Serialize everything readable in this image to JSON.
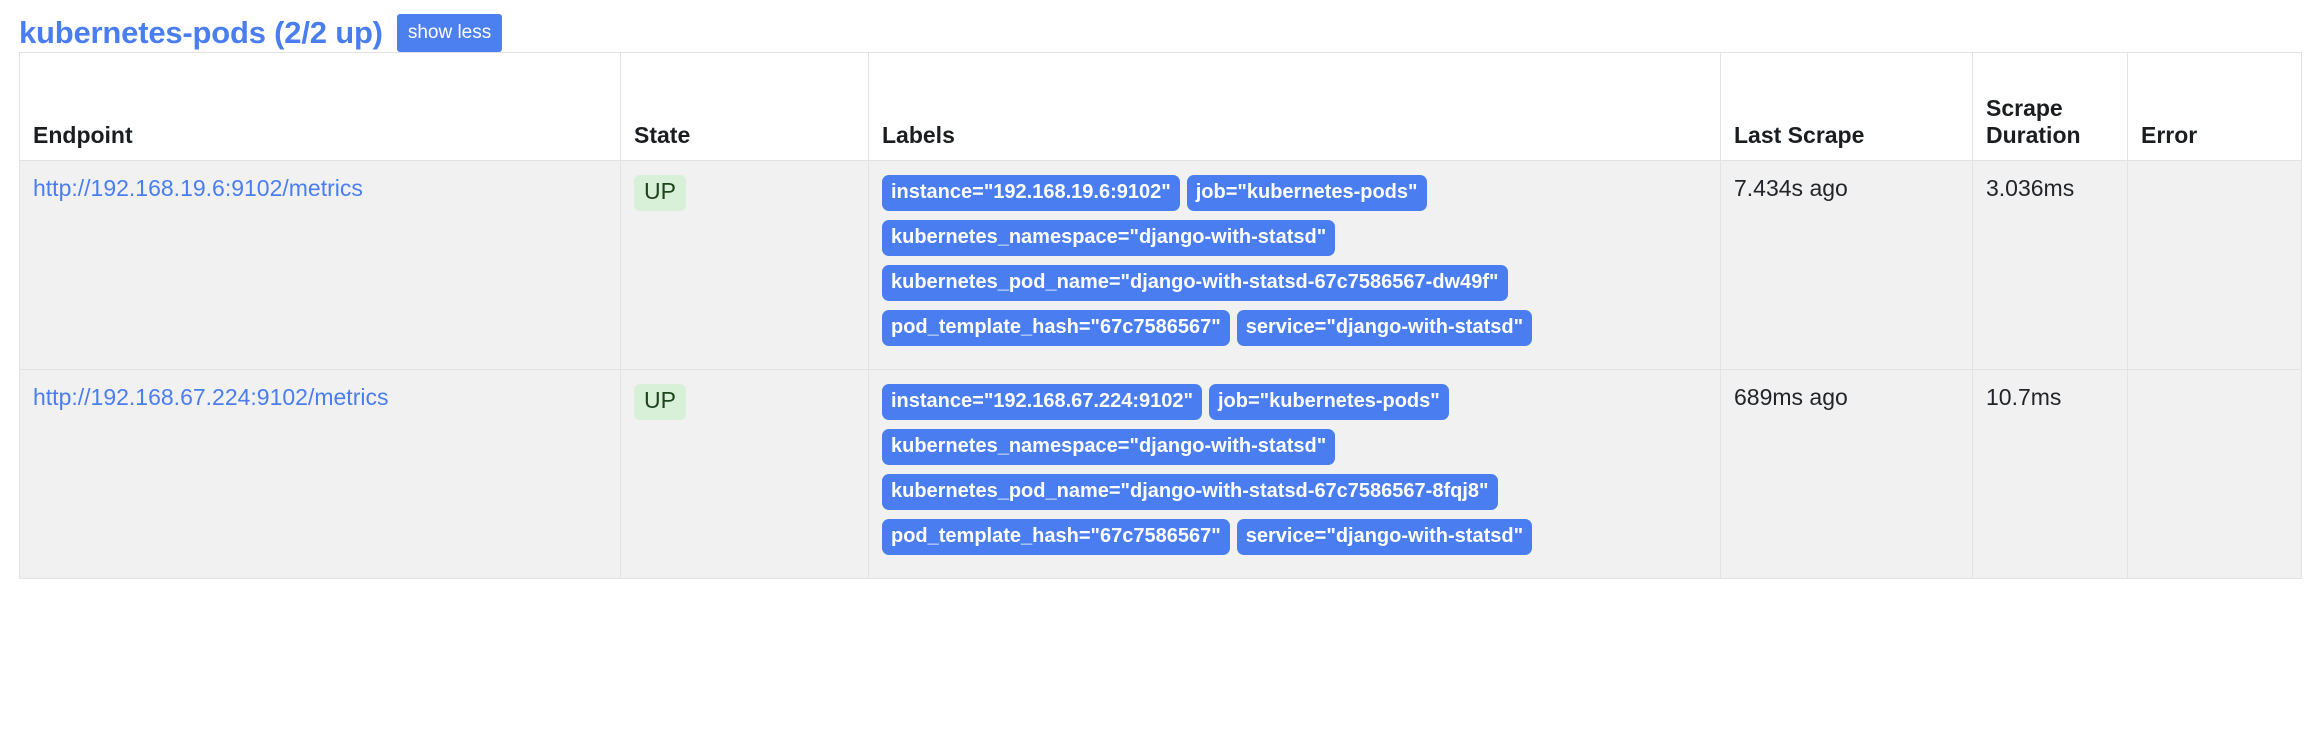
{
  "header": {
    "job_title": "kubernetes-pods (2/2 up)",
    "show_less_label": "show less",
    "title_color": "#4a7ef0",
    "button_color": "#4c7fef"
  },
  "table": {
    "columns": [
      {
        "key": "endpoint",
        "label": "Endpoint"
      },
      {
        "key": "state",
        "label": "State"
      },
      {
        "key": "labels",
        "label": "Labels"
      },
      {
        "key": "last_scrape",
        "label": "Last Scrape"
      },
      {
        "key": "scrape_duration",
        "label": "Scrape Duration"
      },
      {
        "key": "error",
        "label": "Error"
      }
    ],
    "rows": [
      {
        "endpoint": "http://192.168.19.6:9102/metrics",
        "state": "UP",
        "labels": [
          "instance=\"192.168.19.6:9102\"",
          "job=\"kubernetes-pods\"",
          "kubernetes_namespace=\"django-with-statsd\"",
          "kubernetes_pod_name=\"django-with-statsd-67c7586567-dw49f\"",
          "pod_template_hash=\"67c7586567\"",
          "service=\"django-with-statsd\""
        ],
        "last_scrape": "7.434s ago",
        "scrape_duration": "3.036ms",
        "error": ""
      },
      {
        "endpoint": "http://192.168.67.224:9102/metrics",
        "state": "UP",
        "labels": [
          "instance=\"192.168.67.224:9102\"",
          "job=\"kubernetes-pods\"",
          "kubernetes_namespace=\"django-with-statsd\"",
          "kubernetes_pod_name=\"django-with-statsd-67c7586567-8fqj8\"",
          "pod_template_hash=\"67c7586567\"",
          "service=\"django-with-statsd\""
        ],
        "last_scrape": "689ms ago",
        "scrape_duration": "10.7ms",
        "error": ""
      }
    ]
  },
  "colors": {
    "label_badge_bg": "#4a7ef0",
    "state_up_bg": "#d8efd8",
    "state_up_text": "#1d441d",
    "row_bg": "#f1f1f2",
    "border": "#e3e3e5"
  }
}
